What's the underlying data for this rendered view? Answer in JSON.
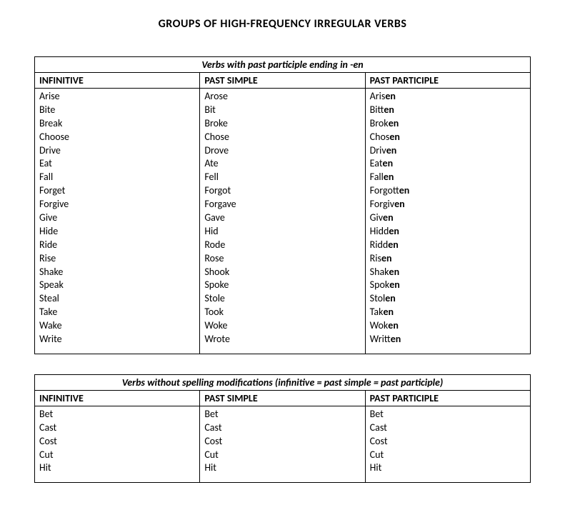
{
  "title": "GROUPS OF HIGH-FREQUENCY IRREGULAR VERBS",
  "tables": [
    {
      "caption": "Verbs with past participle ending in -en",
      "headers": [
        "INFINITIVE",
        "PAST SIMPLE",
        "PAST PARTICIPLE"
      ],
      "rows": [
        {
          "inf": "Arise",
          "past": "Arose",
          "pp_stem": "Aris",
          "pp_suf": "en"
        },
        {
          "inf": "Bite",
          "past": "Bit",
          "pp_stem": "Bitt",
          "pp_suf": "en"
        },
        {
          "inf": "Break",
          "past": "Broke",
          "pp_stem": "Brok",
          "pp_suf": "en"
        },
        {
          "inf": "Choose",
          "past": "Chose",
          "pp_stem": "Chos",
          "pp_suf": "en"
        },
        {
          "inf": "Drive",
          "past": "Drove",
          "pp_stem": "Driv",
          "pp_suf": "en"
        },
        {
          "inf": "Eat",
          "past": "Ate",
          "pp_stem": "Eat",
          "pp_suf": "en"
        },
        {
          "inf": "Fall",
          "past": "Fell",
          "pp_stem": "Fall",
          "pp_suf": "en"
        },
        {
          "inf": "Forget",
          "past": "Forgot",
          "pp_stem": "Forgott",
          "pp_suf": "en"
        },
        {
          "inf": "Forgive",
          "past": "Forgave",
          "pp_stem": "Forgiv",
          "pp_suf": "en"
        },
        {
          "inf": "Give",
          "past": "Gave",
          "pp_stem": "Giv",
          "pp_suf": "en"
        },
        {
          "inf": "Hide",
          "past": "Hid",
          "pp_stem": "Hidd",
          "pp_suf": "en"
        },
        {
          "inf": "Ride",
          "past": "Rode",
          "pp_stem": "Ridd",
          "pp_suf": "en"
        },
        {
          "inf": "Rise",
          "past": "Rose",
          "pp_stem": "Ris",
          "pp_suf": "en"
        },
        {
          "inf": "Shake",
          "past": "Shook",
          "pp_stem": "Shak",
          "pp_suf": "en"
        },
        {
          "inf": "Speak",
          "past": "Spoke",
          "pp_stem": "Spok",
          "pp_suf": "en"
        },
        {
          "inf": "Steal",
          "past": "Stole",
          "pp_stem": "Stol",
          "pp_suf": "en"
        },
        {
          "inf": "Take",
          "past": "Took",
          "pp_stem": "Tak",
          "pp_suf": "en"
        },
        {
          "inf": "Wake",
          "past": "Woke",
          "pp_stem": "Wok",
          "pp_suf": "en"
        },
        {
          "inf": "Write",
          "past": "Wrote",
          "pp_stem": "Writt",
          "pp_suf": "en"
        }
      ]
    },
    {
      "caption": "Verbs without spelling modifications (infinitive = past simple = past participle)",
      "headers": [
        "INFINITIVE",
        "PAST SIMPLE",
        "PAST PARTICIPLE"
      ],
      "rows": [
        {
          "inf": "Bet",
          "past": "Bet",
          "pp_stem": "Bet",
          "pp_suf": ""
        },
        {
          "inf": "Cast",
          "past": "Cast",
          "pp_stem": "Cast",
          "pp_suf": ""
        },
        {
          "inf": "Cost",
          "past": "Cost",
          "pp_stem": "Cost",
          "pp_suf": ""
        },
        {
          "inf": "Cut",
          "past": "Cut",
          "pp_stem": "Cut",
          "pp_suf": ""
        },
        {
          "inf": "Hit",
          "past": "Hit",
          "pp_stem": "Hit",
          "pp_suf": ""
        }
      ]
    }
  ]
}
